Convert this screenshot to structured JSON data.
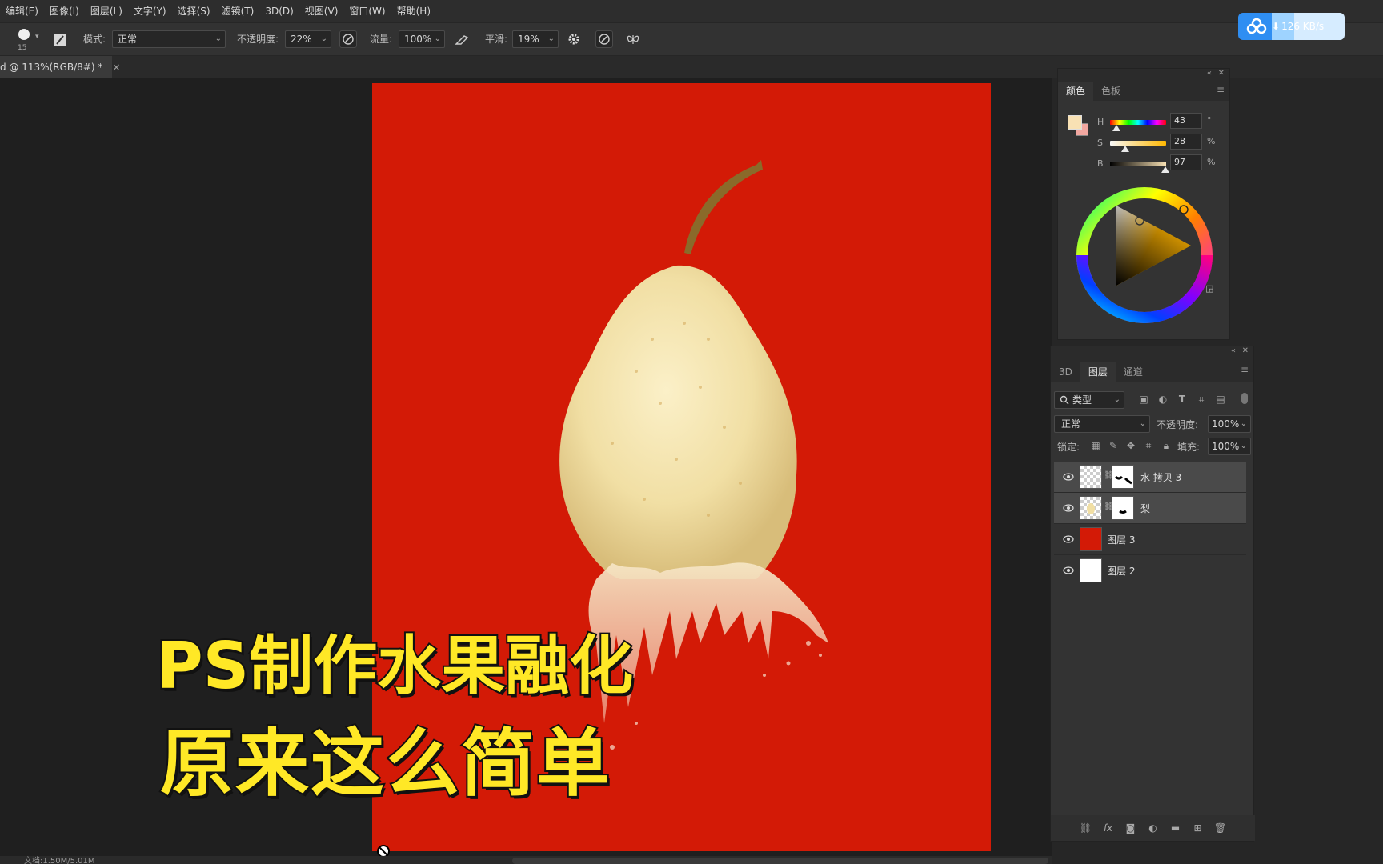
{
  "menubar": {
    "items": [
      "编辑(E)",
      "图像(I)",
      "图层(L)",
      "文字(Y)",
      "选择(S)",
      "滤镜(T)",
      "3D(D)",
      "视图(V)",
      "窗口(W)",
      "帮助(H)"
    ]
  },
  "options": {
    "brush_size": "15",
    "mode_label": "模式:",
    "mode_value": "正常",
    "opacity_label": "不透明度:",
    "opacity_value": "22%",
    "flow_label": "流量:",
    "flow_value": "100%",
    "smooth_label": "平滑:",
    "smooth_value": "19%"
  },
  "transfer": {
    "speed": "126 KB/s"
  },
  "document_tab": {
    "title": "d @ 113%(RGB/8#) *",
    "close": "×"
  },
  "overlay_title": {
    "line1": "PS制作水果融化",
    "line2": "原来这么简单"
  },
  "status": {
    "doc_size": "文档:1.50M/5.01M"
  },
  "color_panel": {
    "tabs": [
      "颜色",
      "色板"
    ],
    "h_key": "H",
    "h_value": "43",
    "h_unit": "°",
    "s_key": "S",
    "s_value": "28",
    "s_unit": "%",
    "b_key": "B",
    "b_value": "97",
    "b_unit": "%",
    "foreground_color": "#f8e1b4",
    "background_color": "#f2a7a0"
  },
  "layers_panel": {
    "tabs": [
      "3D",
      "图层",
      "通道"
    ],
    "filter_label": "类型",
    "blend_mode": "正常",
    "opacity_label": "不透明度:",
    "opacity_value": "100%",
    "lock_label": "锁定:",
    "fill_label": "填充:",
    "fill_value": "100%",
    "layers": [
      {
        "name": "水 拷贝 3"
      },
      {
        "name": "梨"
      },
      {
        "name": "图层 3"
      },
      {
        "name": "图层 2"
      }
    ]
  },
  "colors": {
    "canvas_red": "#d31a06",
    "title_yellow": "#ffe826",
    "badge_blue": "#2f8ef2"
  }
}
